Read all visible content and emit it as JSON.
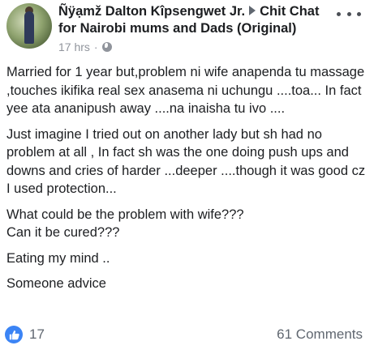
{
  "post": {
    "author": "Ñÿạmž Dalton Kîpsengwet Jr.",
    "group": "Chit Chat for Nairobi mums and Dads (Original)",
    "time": "17 hrs",
    "separator": "·",
    "privacy_icon": "globe-icon",
    "more_icon": "more-options-icon",
    "paragraphs": [
      "Married for 1 year but,problem ni wife anapenda tu massage ,touches ikifika real sex anasema ni uchungu ....toa... In fact yee ata ananipush away ....na inaisha tu ivo ....",
      "Just imagine I tried out on another lady but sh had no problem at all , In fact sh was the one doing push ups and downs and cries of harder ...deeper ....though it was good cz I used protection...",
      "What could be the problem with wife???\nCan it be cured???",
      "Eating my mind ..",
      "Someone advice"
    ]
  },
  "footer": {
    "like_count": "17",
    "comments_label": "61 Comments",
    "reaction_icon": "thumbs-up-icon",
    "accent": "#3b84f5"
  }
}
